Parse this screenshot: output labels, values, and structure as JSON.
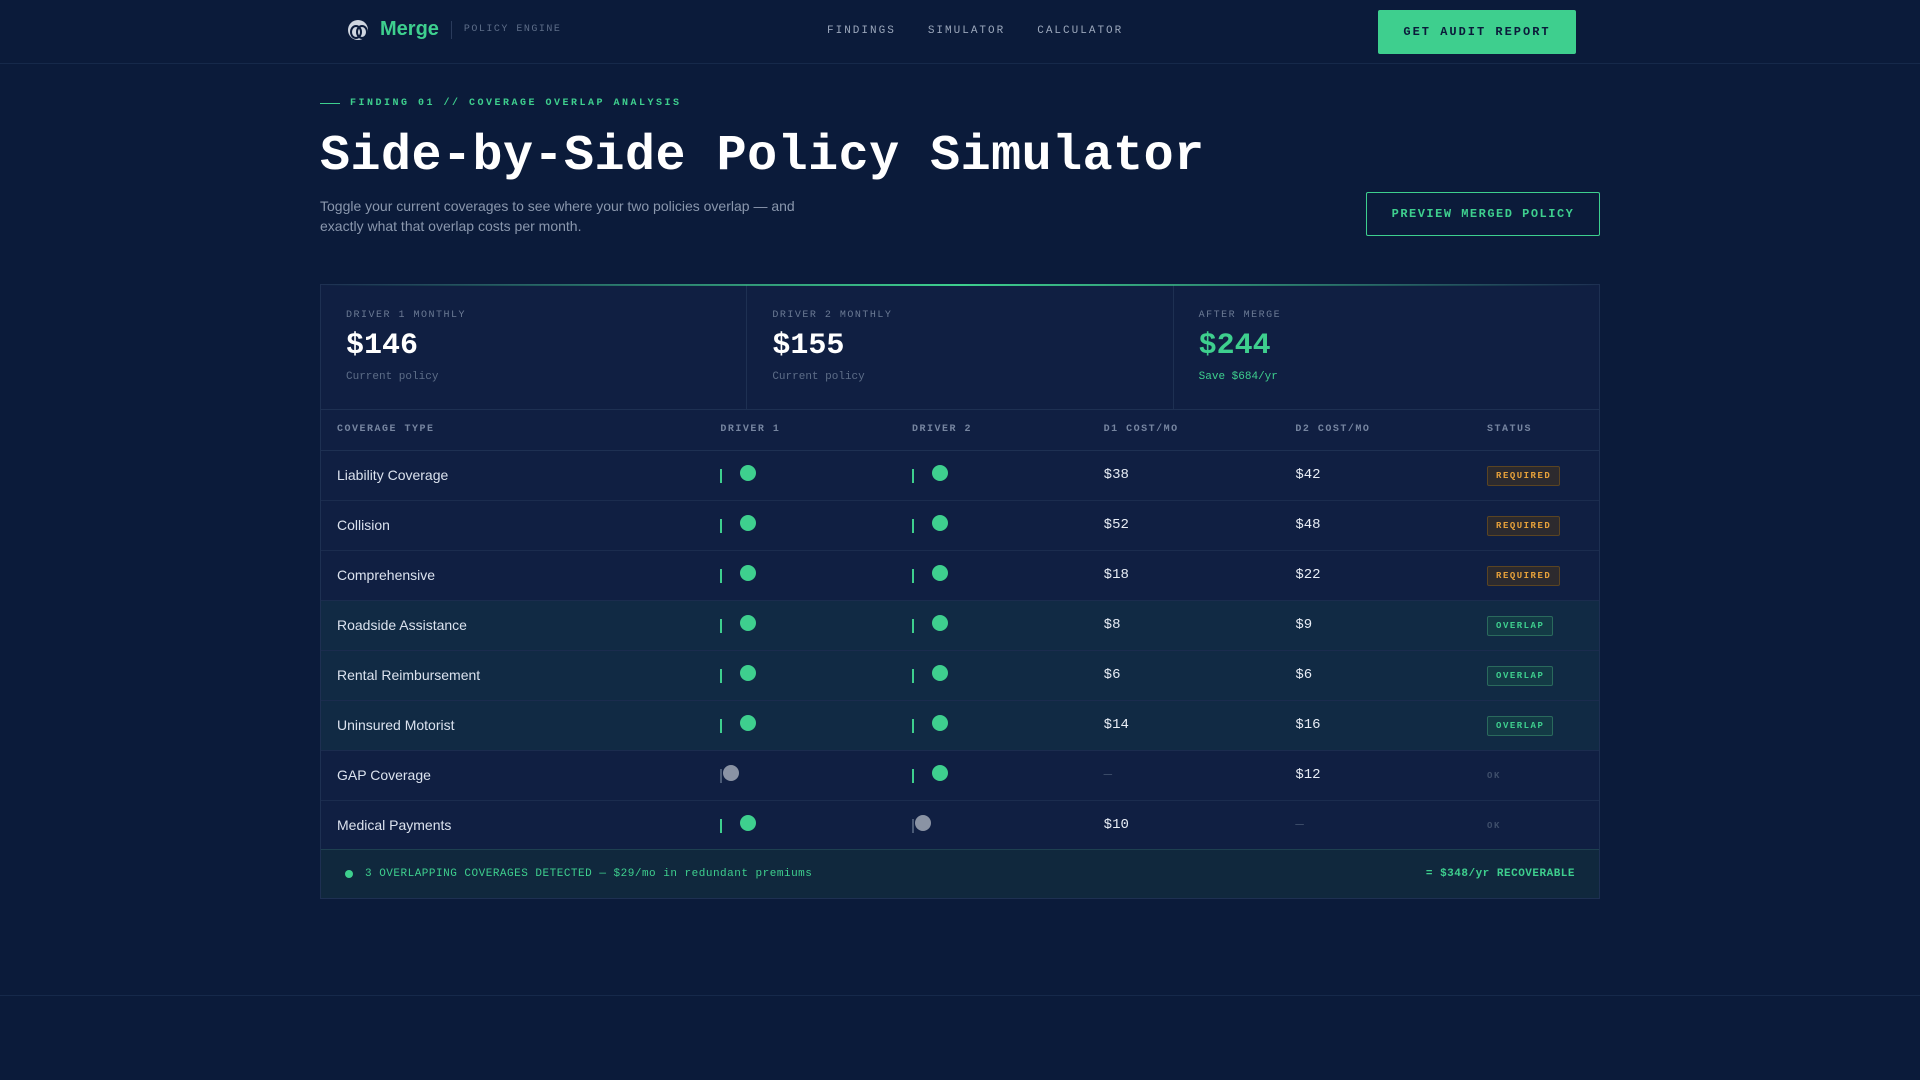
{
  "brand": {
    "name": "Merge",
    "tagline": "POLICY ENGINE",
    "logo_icon": "brain-icon"
  },
  "nav": {
    "links": [
      "FINDINGS",
      "SIMULATOR",
      "CALCULATOR"
    ],
    "cta": "GET AUDIT REPORT"
  },
  "hero": {
    "eyebrow": "FINDING 01 // COVERAGE OVERLAP ANALYSIS",
    "title": "Side-by-Side Policy Simulator",
    "subtitle": "Toggle your current coverages to see where your two policies overlap — and exactly what that overlap costs per month.",
    "preview_button": "PREVIEW MERGED POLICY"
  },
  "stats": [
    {
      "label": "DRIVER 1 MONTHLY",
      "value": "$146",
      "sub": "Current policy"
    },
    {
      "label": "DRIVER 2 MONTHLY",
      "value": "$155",
      "sub": "Current policy"
    },
    {
      "label": "AFTER MERGE",
      "value": "$244",
      "sub": "Save $684/yr"
    }
  ],
  "table": {
    "headers": [
      "COVERAGE TYPE",
      "DRIVER 1",
      "DRIVER 2",
      "D1 COST/MO",
      "D2 COST/MO",
      "STATUS"
    ],
    "rows": [
      {
        "coverage": "Liability Coverage",
        "d1_on": true,
        "d2_on": true,
        "d1_cost": "$38",
        "d2_cost": "$42",
        "status": "REQUIRED",
        "kind": "required"
      },
      {
        "coverage": "Collision",
        "d1_on": true,
        "d2_on": true,
        "d1_cost": "$52",
        "d2_cost": "$48",
        "status": "REQUIRED",
        "kind": "required"
      },
      {
        "coverage": "Comprehensive",
        "d1_on": true,
        "d2_on": true,
        "d1_cost": "$18",
        "d2_cost": "$22",
        "status": "REQUIRED",
        "kind": "required"
      },
      {
        "coverage": "Roadside Assistance",
        "d1_on": true,
        "d2_on": true,
        "d1_cost": "$8",
        "d2_cost": "$9",
        "status": "OVERLAP",
        "kind": "overlap"
      },
      {
        "coverage": "Rental Reimbursement",
        "d1_on": true,
        "d2_on": true,
        "d1_cost": "$6",
        "d2_cost": "$6",
        "status": "OVERLAP",
        "kind": "overlap"
      },
      {
        "coverage": "Uninsured Motorist",
        "d1_on": true,
        "d2_on": true,
        "d1_cost": "$14",
        "d2_cost": "$16",
        "status": "OVERLAP",
        "kind": "overlap"
      },
      {
        "coverage": "GAP Coverage",
        "d1_on": false,
        "d2_on": true,
        "d1_cost": "—",
        "d2_cost": "$12",
        "status": "OK",
        "kind": "ok"
      },
      {
        "coverage": "Medical Payments",
        "d1_on": true,
        "d2_on": false,
        "d1_cost": "$10",
        "d2_cost": "—",
        "status": "OK",
        "kind": "ok"
      }
    ]
  },
  "footer": {
    "summary": "3 OVERLAPPING COVERAGES DETECTED — $29/mo in redundant premiums",
    "recoverable": "= $348/yr RECOVERABLE"
  },
  "colors": {
    "accent": "#3ecf8e",
    "background": "#0b1b3a",
    "panel": "#101f42",
    "warning": "#e8a23a"
  }
}
